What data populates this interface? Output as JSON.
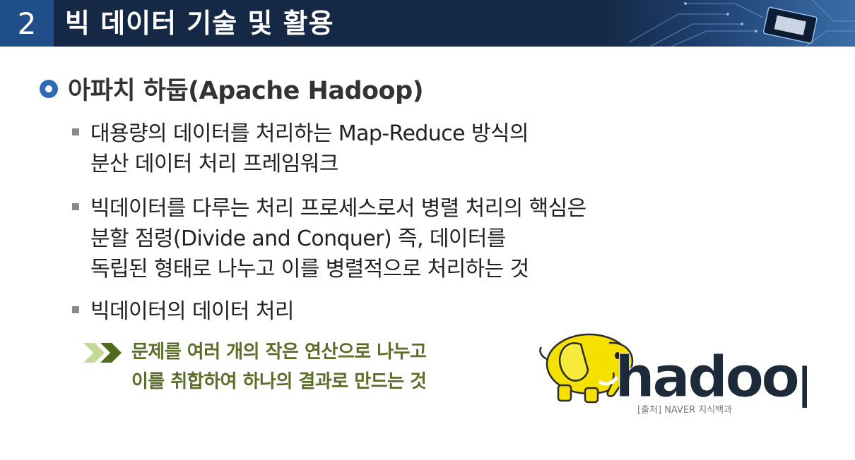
{
  "header": {
    "section_number": "2",
    "title": "빅 데이터 기술 및 활용"
  },
  "heading": "아파치 하둡(Apache Hadoop)",
  "bullets": [
    {
      "lines": [
        "대용량의 데이터를 처리하는 Map-Reduce 방식의",
        "분산 데이터 처리 프레임워크"
      ]
    },
    {
      "lines": [
        "빅데이터를 다루는 처리 프로세스로서 병렬 처리의 핵심은",
        "분할 점령(Divide and Conquer) 즉, 데이터를",
        "독립된 형태로 나누고 이를 병렬적으로 처리하는 것"
      ]
    },
    {
      "lines": [
        "빅데이터의 데이터 처리"
      ]
    }
  ],
  "sub_point": {
    "lines": [
      "문제를 여러 개의 작은 연산으로 나누고",
      "이를 취합하여 하나의 결과로 만드는 것"
    ]
  },
  "logo": {
    "wordmark": "hadoop",
    "credit": "[출처] NAVER 지식백과"
  },
  "icons": {
    "heading_bullet": "circle-bullet-icon",
    "bullet": "square-bullet-icon",
    "sub_bullet": "double-chevron-icon",
    "logo": "yellow-elephant-icon"
  },
  "colors": {
    "header_bg": "#152845",
    "section_badge": "#1f4e89",
    "accent_blue": "#2e6bb5",
    "sub_text_green": "#5b6e29",
    "logo_yellow": "#f5e100",
    "logo_text": "#1c2a3a"
  }
}
